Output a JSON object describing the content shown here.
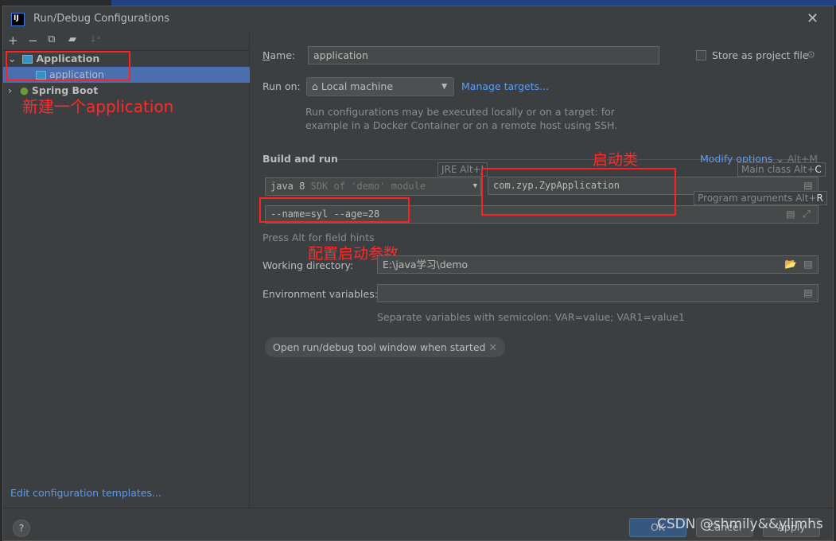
{
  "window": {
    "title": "Run/Debug Configurations",
    "logo": "IJ"
  },
  "toolbar": {
    "icons": [
      "plus-icon",
      "minus-icon",
      "copy-icon",
      "folder-add-icon",
      "sort-icon"
    ],
    "sort_glyph": "↓ᵃ"
  },
  "tree": {
    "items": [
      {
        "label": "Application",
        "expanded": true
      },
      {
        "label": "application",
        "selected": true
      },
      {
        "label": "Spring Boot",
        "expanded": false
      }
    ]
  },
  "edit_templates": "Edit configuration templates...",
  "form": {
    "name_label": "Name:",
    "name_value": "application",
    "store_label": "Store as project file",
    "run_on_label": "Run on:",
    "run_on_value": "Local machine",
    "manage_targets": "Manage targets...",
    "run_on_desc_1": "Run configurations may be executed locally or on a target: for",
    "run_on_desc_2": "example in a Docker Container or on a remote host using SSH.",
    "build_run": "Build and run",
    "modify_options": "Modify options",
    "modify_shortcut": "Alt+M",
    "jre_tip": "JRE Alt+J",
    "jre_value": "java 8",
    "jre_hint": "SDK of 'demo' module",
    "main_class": "com.zyp.ZypApplication",
    "main_class_tip": "Main class Alt+",
    "main_class_key": "C",
    "program_args": "--name=syl --age=28",
    "program_args_tip": "Program arguments Alt+",
    "program_args_key": "R",
    "field_hints": "Press Alt for field hints",
    "workdir_label": "Working directory:",
    "workdir_value": "E:\\java学习\\demo",
    "env_label": "Environment variables:",
    "env_value": "",
    "env_hint": "Separate variables with semicolon: VAR=value; VAR1=value1",
    "open_tool_window": "Open run/debug tool window when started"
  },
  "annotations": {
    "new_app": "新建一个application",
    "main_class": "启动类",
    "args": "配置启动参数"
  },
  "footer": {
    "help": "?",
    "ok": "OK",
    "cancel": "Cancel",
    "apply": "Apply",
    "watermark": "CSDN @shmily&&ylimhs"
  }
}
